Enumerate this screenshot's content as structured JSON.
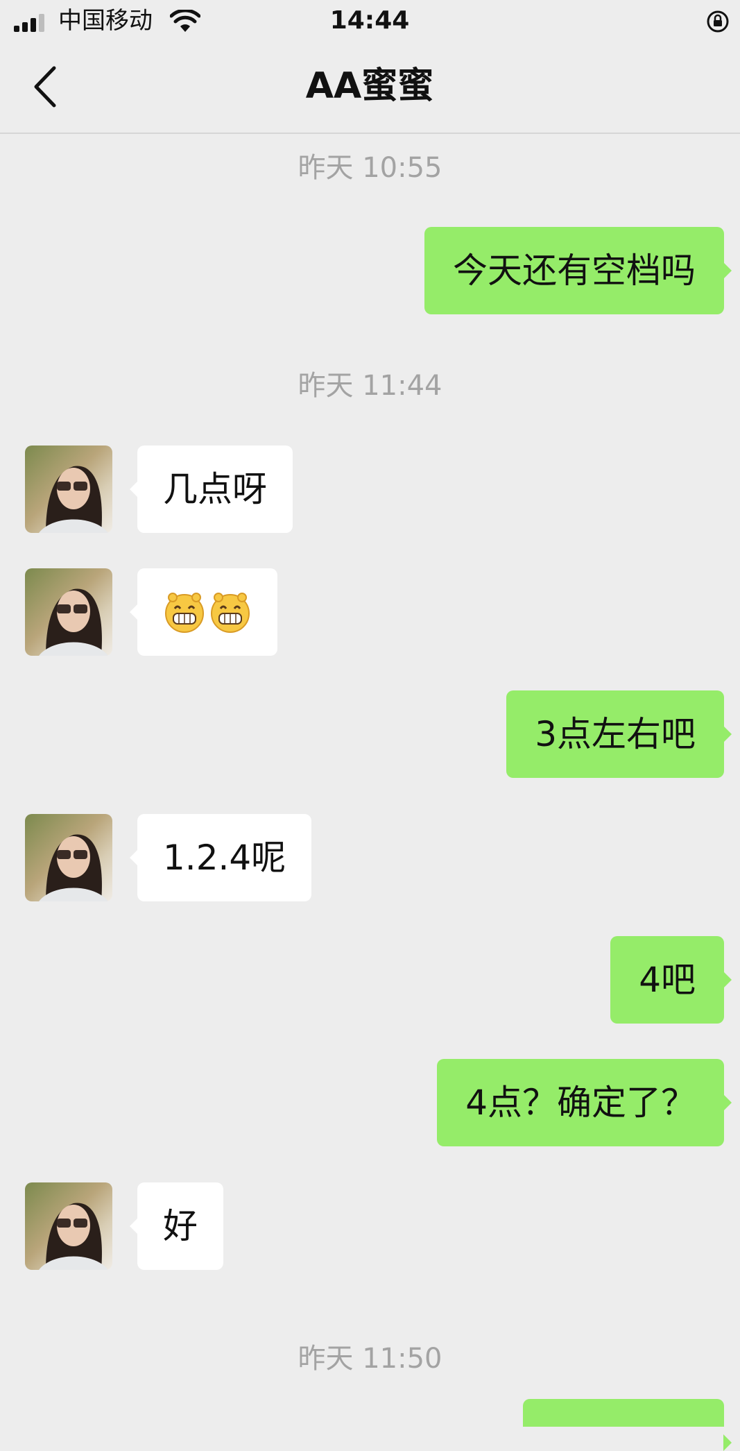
{
  "status_bar": {
    "carrier": "中国移动",
    "time": "14:44"
  },
  "header": {
    "title": "AA蜜蜜"
  },
  "messages": [
    {
      "type": "timestamp",
      "text": "昨天 10:55"
    },
    {
      "type": "sent",
      "text": "今天还有空档吗"
    },
    {
      "type": "timestamp",
      "text": "昨天 11:44"
    },
    {
      "type": "received",
      "text": "几点呀"
    },
    {
      "type": "received",
      "content": "grinning-emoji x2"
    },
    {
      "type": "sent",
      "text": "3点左右吧"
    },
    {
      "type": "received",
      "text": "1.2.4呢"
    },
    {
      "type": "sent",
      "text": "4吧"
    },
    {
      "type": "sent",
      "text": "4点？确定了？"
    },
    {
      "type": "received",
      "text": "好"
    },
    {
      "type": "timestamp",
      "text": "昨天 11:50"
    }
  ],
  "colors": {
    "background": "#ededed",
    "sent_bubble": "#95ec69",
    "received_bubble": "#ffffff",
    "timestamp_text": "#a3a3a3"
  },
  "icons": [
    "signal-icon",
    "wifi-icon",
    "rotation-lock-icon",
    "back-arrow-icon",
    "grinning-emoji-icon"
  ]
}
